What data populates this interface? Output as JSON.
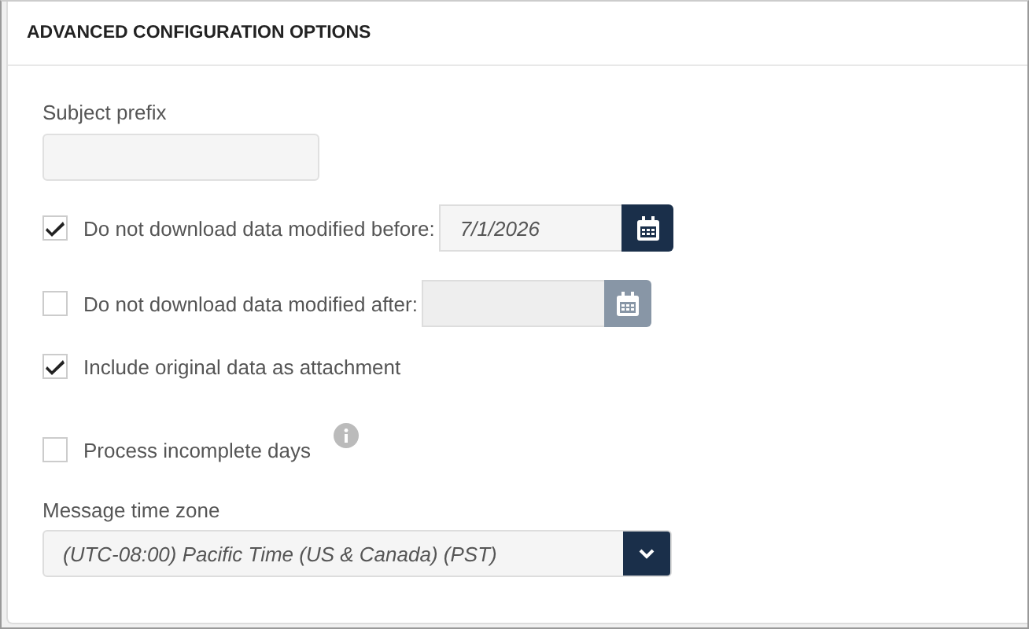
{
  "panel": {
    "title": "ADVANCED CONFIGURATION OPTIONS"
  },
  "subject_prefix": {
    "label": "Subject prefix"
  },
  "options": [
    {
      "kind": "date",
      "label": "Do not download data modified before:",
      "checked": true,
      "value": "7/1/2026",
      "disabled": false
    },
    {
      "kind": "date",
      "label": "Do not download data modified after:",
      "checked": false,
      "disabled": true
    },
    {
      "kind": "plain",
      "label": "Include original data as attachment",
      "checked": true
    },
    {
      "kind": "info",
      "label": "Process incomplete days",
      "checked": false
    }
  ],
  "time_zone": {
    "label": "Message time zone",
    "value": "(UTC-08:00) Pacific Time (US & Canada) (PST)"
  }
}
